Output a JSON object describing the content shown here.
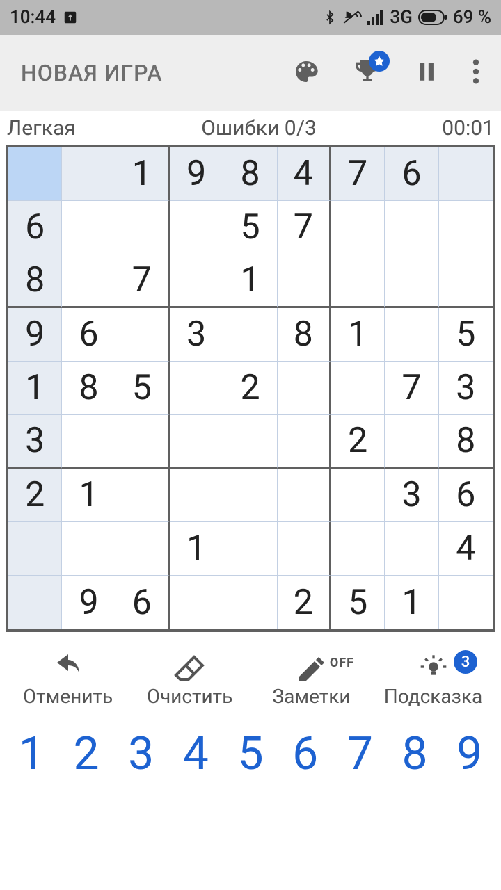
{
  "status": {
    "time": "10:44",
    "network": "3G",
    "battery": "69 %"
  },
  "appbar": {
    "title": "НОВАЯ ИГРА"
  },
  "info": {
    "difficulty": "Легкая",
    "mistakes_label": "Ошибки 0/3",
    "timer": "00:01"
  },
  "board": {
    "selected": [
      0,
      0
    ],
    "cells": [
      [
        {
          "v": "",
          "g": true
        },
        {
          "v": "",
          "g": true
        },
        {
          "v": "1",
          "g": true
        },
        {
          "v": "9",
          "g": true
        },
        {
          "v": "8",
          "g": true
        },
        {
          "v": "4",
          "g": true
        },
        {
          "v": "7",
          "g": true
        },
        {
          "v": "6",
          "g": true
        },
        {
          "v": "",
          "g": true
        }
      ],
      [
        {
          "v": "6",
          "g": true
        },
        {
          "v": "",
          "g": false
        },
        {
          "v": "",
          "g": false
        },
        {
          "v": "",
          "g": false
        },
        {
          "v": "5",
          "g": false
        },
        {
          "v": "7",
          "g": false
        },
        {
          "v": "",
          "g": false
        },
        {
          "v": "",
          "g": false
        },
        {
          "v": "",
          "g": false
        }
      ],
      [
        {
          "v": "8",
          "g": true
        },
        {
          "v": "",
          "g": false
        },
        {
          "v": "7",
          "g": false
        },
        {
          "v": "",
          "g": false
        },
        {
          "v": "1",
          "g": false
        },
        {
          "v": "",
          "g": false
        },
        {
          "v": "",
          "g": false
        },
        {
          "v": "",
          "g": false
        },
        {
          "v": "",
          "g": false
        }
      ],
      [
        {
          "v": "9",
          "g": true
        },
        {
          "v": "6",
          "g": false
        },
        {
          "v": "",
          "g": false
        },
        {
          "v": "3",
          "g": false
        },
        {
          "v": "",
          "g": false
        },
        {
          "v": "8",
          "g": false
        },
        {
          "v": "1",
          "g": false
        },
        {
          "v": "",
          "g": false
        },
        {
          "v": "5",
          "g": false
        }
      ],
      [
        {
          "v": "1",
          "g": true
        },
        {
          "v": "8",
          "g": false
        },
        {
          "v": "5",
          "g": false
        },
        {
          "v": "",
          "g": false
        },
        {
          "v": "2",
          "g": false
        },
        {
          "v": "",
          "g": false
        },
        {
          "v": "",
          "g": false
        },
        {
          "v": "7",
          "g": false
        },
        {
          "v": "3",
          "g": false
        }
      ],
      [
        {
          "v": "3",
          "g": true
        },
        {
          "v": "",
          "g": false
        },
        {
          "v": "",
          "g": false
        },
        {
          "v": "",
          "g": false
        },
        {
          "v": "",
          "g": false
        },
        {
          "v": "",
          "g": false
        },
        {
          "v": "2",
          "g": false
        },
        {
          "v": "",
          "g": false
        },
        {
          "v": "8",
          "g": false
        }
      ],
      [
        {
          "v": "2",
          "g": true
        },
        {
          "v": "1",
          "g": false
        },
        {
          "v": "",
          "g": false
        },
        {
          "v": "",
          "g": false
        },
        {
          "v": "",
          "g": false
        },
        {
          "v": "",
          "g": false
        },
        {
          "v": "",
          "g": false
        },
        {
          "v": "3",
          "g": false
        },
        {
          "v": "6",
          "g": false
        }
      ],
      [
        {
          "v": "",
          "g": true
        },
        {
          "v": "",
          "g": false
        },
        {
          "v": "",
          "g": false
        },
        {
          "v": "1",
          "g": false
        },
        {
          "v": "",
          "g": false
        },
        {
          "v": "",
          "g": false
        },
        {
          "v": "",
          "g": false
        },
        {
          "v": "",
          "g": false
        },
        {
          "v": "4",
          "g": false
        }
      ],
      [
        {
          "v": "",
          "g": true
        },
        {
          "v": "9",
          "g": false
        },
        {
          "v": "6",
          "g": false
        },
        {
          "v": "",
          "g": false
        },
        {
          "v": "",
          "g": false
        },
        {
          "v": "2",
          "g": false
        },
        {
          "v": "5",
          "g": false
        },
        {
          "v": "1",
          "g": false
        },
        {
          "v": "",
          "g": false
        }
      ]
    ]
  },
  "tools": {
    "undo": "Отменить",
    "erase": "Очистить",
    "notes": "Заметки",
    "notes_state": "OFF",
    "hint": "Подсказка",
    "hint_count": "3"
  },
  "numpad": [
    "1",
    "2",
    "3",
    "4",
    "5",
    "6",
    "7",
    "8",
    "9"
  ]
}
